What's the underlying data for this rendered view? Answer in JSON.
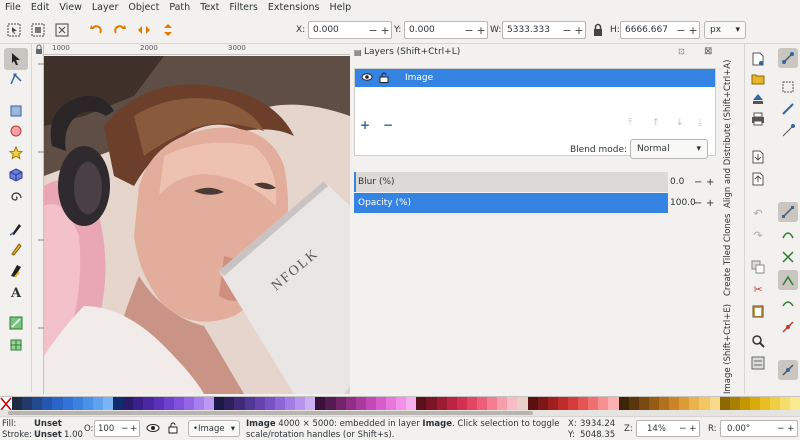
{
  "menu": [
    "File",
    "Edit",
    "View",
    "Layer",
    "Object",
    "Path",
    "Text",
    "Filters",
    "Extensions",
    "Help"
  ],
  "controls": {
    "x_label": "X:",
    "x_value": "0.000",
    "y_label": "Y:",
    "y_value": "0.000",
    "w_label": "W:",
    "w_value": "5333.333",
    "h_label": "H:",
    "h_value": "6666.667",
    "unit": "px"
  },
  "rulers": {
    "top": [
      "1000",
      "2000",
      "3000"
    ]
  },
  "layers_panel": {
    "title": "Layers (Shift+Ctrl+L)",
    "layer_name": "Image",
    "blend_label": "Blend mode:",
    "blend_value": "Normal",
    "blur_label": "Blur (%)",
    "blur_value": "0.0",
    "opacity_label": "Opacity (%)",
    "opacity_value": "100.0"
  },
  "docks": {
    "align": "Align and Distribute (Shift+Ctrl+A)",
    "tiled": "Create Tiled Clones",
    "image": "Image (Shift+Ctrl+E)"
  },
  "status": {
    "fill_label": "Fill:",
    "fill_value": "Unset",
    "stroke_label": "Stroke:",
    "stroke_value": "Unset",
    "stroke_width": "1.00",
    "opacity_label": "O:",
    "opacity_value": "100",
    "layer_select": "•Image",
    "message_bold": "Image",
    "message_1": " 4000 × 5000: embedded in layer ",
    "message_layer": "Image",
    "message_2": ". Click selection to toggle",
    "message_3": "scale/rotation handles (or Shift+s).",
    "x_label": "X:",
    "x_value": "3934.24",
    "y_label": "Y:",
    "y_value": "5048.35",
    "zoom_label": "Z:",
    "zoom_value": "14%",
    "rot_label": "R:",
    "rot_value": "0.00°"
  },
  "palette_colors": [
    "#1f2a44",
    "#223a6b",
    "#234a8d",
    "#2557b0",
    "#2a64c9",
    "#3173d8",
    "#3a82e0",
    "#4a92e8",
    "#5ea2ee",
    "#7ab4f2",
    "#0e2b6e",
    "#2a1a6e",
    "#3a1f8a",
    "#4b26a3",
    "#5d30bb",
    "#6f3fce",
    "#8151dd",
    "#9466e6",
    "#a77eee",
    "#bb98f3",
    "#1e1646",
    "#2d1f5c",
    "#3e2a78",
    "#513693",
    "#6443ad",
    "#7853c4",
    "#8d67d6",
    "#a27de3",
    "#b895ec",
    "#cdb0f3",
    "#3b0f3a",
    "#561a53",
    "#73246d",
    "#902e86",
    "#ab3aa0",
    "#c449b8",
    "#d75dcc",
    "#e676dc",
    "#f092e7",
    "#f6afef",
    "#5a0f1c",
    "#7c1427",
    "#9d1a33",
    "#bb2340",
    "#d32f4f",
    "#e34460",
    "#ee5f77",
    "#f47d90",
    "#f89daa",
    "#fbbdc5",
    "#e8d0c8",
    "#5b0f0f",
    "#7d1616",
    "#9f1f1f",
    "#bf2b2b",
    "#d63b3b",
    "#e65353",
    "#f07070",
    "#f68f8f",
    "#fab0b0",
    "#3d2408",
    "#5a360c",
    "#784911",
    "#965c16",
    "#b3701d",
    "#ca8526",
    "#dc9c34",
    "#e9b24a",
    "#f2c667",
    "#f8da8a",
    "#8b6a00",
    "#a88000",
    "#c49600",
    "#d9ab0a",
    "#e8be24",
    "#f1cf45",
    "#f6dd6a",
    "#fae98f"
  ]
}
